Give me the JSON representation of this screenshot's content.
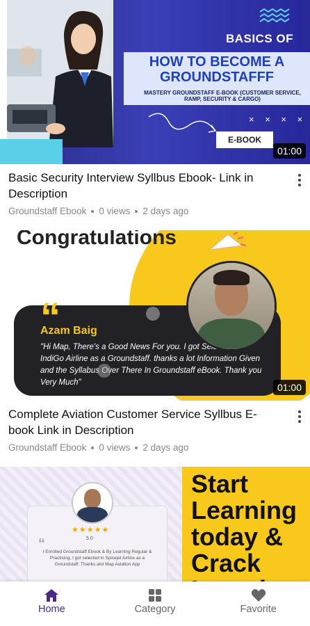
{
  "videos": [
    {
      "title": "Basic Security Interview Syllbus Ebook- Link in Description",
      "channel": "Groundstaff Ebook",
      "views": "0 views",
      "age": "2 days ago",
      "duration": "01:00",
      "thumb": {
        "heading1": "BASICS OF",
        "heading2": "HOW TO BECOME A GROUNDSTAFFF",
        "heading3": "MASTERY GROUNDSTAFF E-BOOK (CUSTOMER SERVICE, RAMP, SECURITY & CARGO)",
        "marks": "× × × ×",
        "ebook": "E-BOOK"
      }
    },
    {
      "title": "Complete Aviation Customer Service Syllbus E-book  Link in Description",
      "channel": "Groundstaff Ebook",
      "views": "0 views",
      "age": "2 days ago",
      "duration": "01:00",
      "thumb": {
        "heading": "Congratulations",
        "quote_mark": "“",
        "name": "Azam Baig",
        "message": "\"Hi Map, There's a Good News For you. I got Selected In IndiGo Airline as a Groundstaff. thanks a lot Information Given and the Syllabus Over There In Groundstaff eBook. Thank you Very Much\""
      }
    },
    {
      "thumb": {
        "stars": "★★★★★",
        "rating": "5.0",
        "quote_mark": "“",
        "review": "I Enrolled Groundstaff Ebook & By Learning Regular & Practising, I got selected in Spicejet Airline as a Groundstaff. Thanks alot Map Aviation App",
        "big_text": "Start Learning today & Crack Interview"
      }
    }
  ],
  "nav": {
    "items": [
      {
        "label": "Home",
        "icon": "home-icon",
        "active": true
      },
      {
        "label": "Category",
        "icon": "grid-icon",
        "active": false
      },
      {
        "label": "Favorite",
        "icon": "heart-icon",
        "active": false
      }
    ],
    "active_color": "#4b2a86",
    "inactive_color": "#666666"
  },
  "colors": {
    "accent_yellow": "#f8c81c",
    "thumb_blue": "#3a3fb5"
  }
}
